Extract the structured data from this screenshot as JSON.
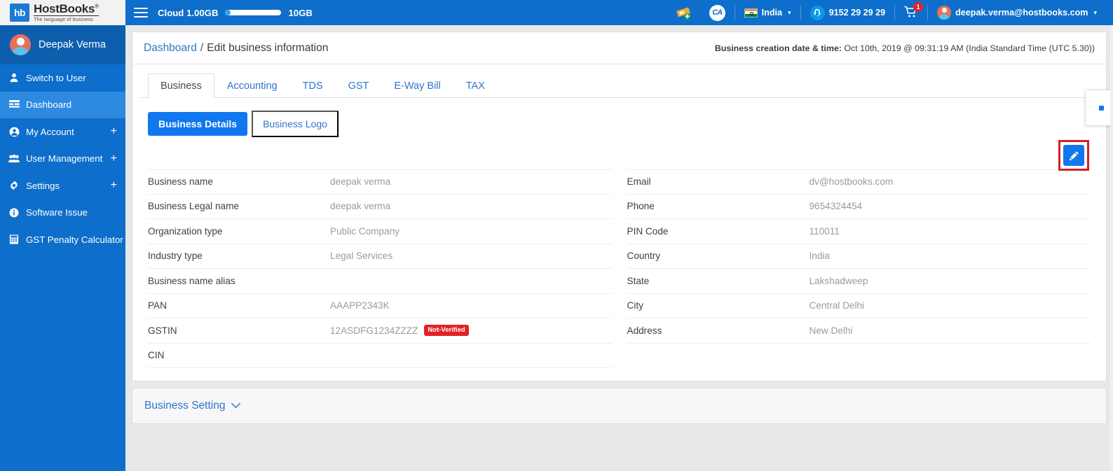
{
  "brand": {
    "mark": "hb",
    "name": "HostBooks",
    "registered": "®",
    "tagline": "The language of business"
  },
  "sidebar": {
    "user_name": "Deepak Verma",
    "items": [
      {
        "label": "Switch to User",
        "icon": "user-icon",
        "expandable": false,
        "active": false
      },
      {
        "label": "Dashboard",
        "icon": "dashboard-icon",
        "expandable": false,
        "active": true
      },
      {
        "label": "My Account",
        "icon": "account-circle-icon",
        "expandable": true,
        "active": false
      },
      {
        "label": "User Management",
        "icon": "users-group-icon",
        "expandable": true,
        "active": false
      },
      {
        "label": "Settings",
        "icon": "gear-icon",
        "expandable": true,
        "active": false
      },
      {
        "label": "Software Issue",
        "icon": "info-icon",
        "expandable": false,
        "active": false
      },
      {
        "label": "GST Penalty Calculator",
        "icon": "calculator-icon",
        "expandable": false,
        "active": false
      }
    ],
    "plus_symbol": "+"
  },
  "topbar": {
    "cloud_label": "Cloud 1.00GB",
    "cloud_max": "10GB",
    "storage_percent": 10,
    "ticket_icon": "add-ticket-icon",
    "ca_badge": "CA",
    "country": "India",
    "country_flag": "india-flag-icon",
    "phone": "9152 29 29 29",
    "cart_count": "1",
    "user_email": "deepak.verma@hostbooks.com",
    "chevron": "⌄"
  },
  "breadcrumb": {
    "root": "Dashboard",
    "separator": "/",
    "current": "Edit business information"
  },
  "creation": {
    "label": "Business creation date & time:",
    "value": "Oct 10th, 2019 @ 09:31:19 AM (India Standard Time (UTC 5.30))"
  },
  "tabs": [
    {
      "label": "Business",
      "active": true
    },
    {
      "label": "Accounting",
      "active": false
    },
    {
      "label": "TDS",
      "active": false
    },
    {
      "label": "GST",
      "active": false
    },
    {
      "label": "E-Way Bill",
      "active": false
    },
    {
      "label": "TAX",
      "active": false
    }
  ],
  "subtabs": {
    "details": "Business Details",
    "logo": "Business Logo"
  },
  "edit": {
    "icon": "pencil-icon",
    "highlight_color": "#d32027",
    "button_color": "#1177ee"
  },
  "fields": {
    "left": [
      {
        "label": "Business name",
        "value": "deepak verma"
      },
      {
        "label": "Business Legal name",
        "value": "deepak verma"
      },
      {
        "label": "Organization type",
        "value": "Public Company"
      },
      {
        "label": "Industry type",
        "value": "Legal Services"
      },
      {
        "label": "Business name alias",
        "value": ""
      },
      {
        "label": "PAN",
        "value": "AAAPP2343K"
      },
      {
        "label": "GSTIN",
        "value": "12ASDFG1234ZZZZ",
        "badge": "Not-Verified"
      },
      {
        "label": "CIN",
        "value": ""
      }
    ],
    "right": [
      {
        "label": "Email",
        "value": "dv@hostbooks.com"
      },
      {
        "label": "Phone",
        "value": "9654324454"
      },
      {
        "label": "PIN Code",
        "value": "110011"
      },
      {
        "label": "Country",
        "value": "India"
      },
      {
        "label": "State",
        "value": "Lakshadweep"
      },
      {
        "label": "City",
        "value": "Central Delhi"
      },
      {
        "label": "Address",
        "value": "New Delhi"
      }
    ]
  },
  "business_setting": {
    "label": "Business Setting",
    "chevron": "chevron-down-icon"
  },
  "colors": {
    "sidebar_blue": "#0d6ecb",
    "accent_blue": "#1177ee",
    "link_blue": "#2e76c9",
    "danger_red": "#e32128"
  }
}
